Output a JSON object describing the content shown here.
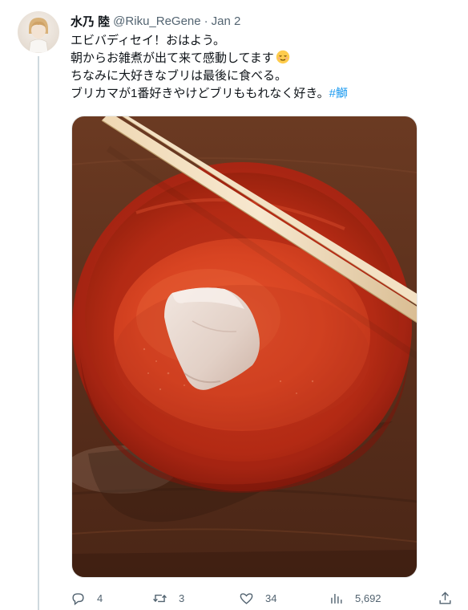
{
  "tweet": {
    "display_name": "水乃 陸",
    "handle": "@Riku_ReGene",
    "separator": "·",
    "date": "Jan 2",
    "lines": [
      "エビバディセイ！おはよう。",
      "朝からお雑煮が出て来て感動してます",
      "ちなみに大好きなブリは最後に食べる。",
      "ブリカマが1番好きやけどブリももれなく好き。"
    ],
    "emoji": "relieved-face-emoji",
    "hashtag": "#鰤"
  },
  "actions": {
    "replies": "4",
    "retweets": "3",
    "likes": "34",
    "views": "5,692"
  },
  "icons": {
    "reply": "reply-icon",
    "retweet": "retweet-icon",
    "like": "heart-icon",
    "views": "views-icon",
    "share": "share-icon"
  },
  "colors": {
    "link": "#1d9bf0",
    "secondary_text": "#536471",
    "primary_text": "#0f1419"
  }
}
